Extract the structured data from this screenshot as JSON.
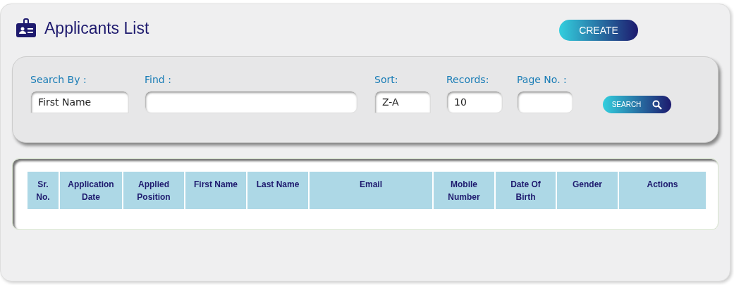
{
  "header": {
    "title": "Applicants List",
    "create_button": "CREATE"
  },
  "search": {
    "fields": [
      {
        "label": "Search By :",
        "value": "First Name",
        "kind": "select"
      },
      {
        "label": "Find :",
        "kind": "text"
      },
      {
        "label": "Sort:",
        "value": "Z-A",
        "kind": "select"
      },
      {
        "label": "Records:",
        "value": "10",
        "kind": "text"
      },
      {
        "label": "Page No. :",
        "kind": "text"
      }
    ],
    "button": "SEARCH"
  },
  "table": {
    "columns": [
      "Sr. No.",
      "Application Date",
      "Applied Position",
      "First Name",
      "Last Name",
      "Email",
      "Mobile Number",
      "Date Of Birth",
      "Gender",
      "Actions"
    ]
  }
}
